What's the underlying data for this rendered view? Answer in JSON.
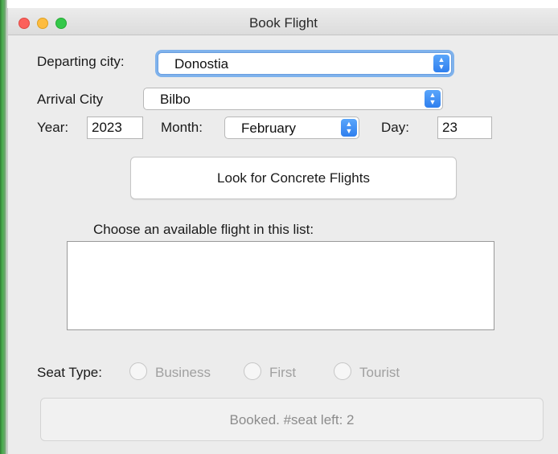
{
  "window": {
    "title": "Book Flight",
    "traffic_lights": [
      "close",
      "minimize",
      "maximize"
    ]
  },
  "departing": {
    "label": "Departing city:",
    "value": "Donostia"
  },
  "arrival": {
    "label": "Arrival City",
    "value": "Bilbo"
  },
  "date": {
    "year_label": "Year:",
    "year_value": "2023",
    "month_label": "Month:",
    "month_value": "February",
    "day_label": "Day:",
    "day_value": "23"
  },
  "search_button": {
    "label": "Look for Concrete Flights"
  },
  "flight_list": {
    "label": "Choose an available flight in this list:",
    "items": []
  },
  "seat": {
    "label": "Seat Type:",
    "options": [
      "Business",
      "First",
      "Tourist"
    ]
  },
  "book_button": {
    "label": "Booked. #seat left: 2",
    "enabled": false
  },
  "colors": {
    "window_bg": "#ececec",
    "accent": "#2f7fee",
    "focus_ring": "#7fb2ec",
    "disabled_text": "#a0a0a0"
  },
  "icons": {
    "combo_arrow": "chevron-up-down-icon"
  }
}
